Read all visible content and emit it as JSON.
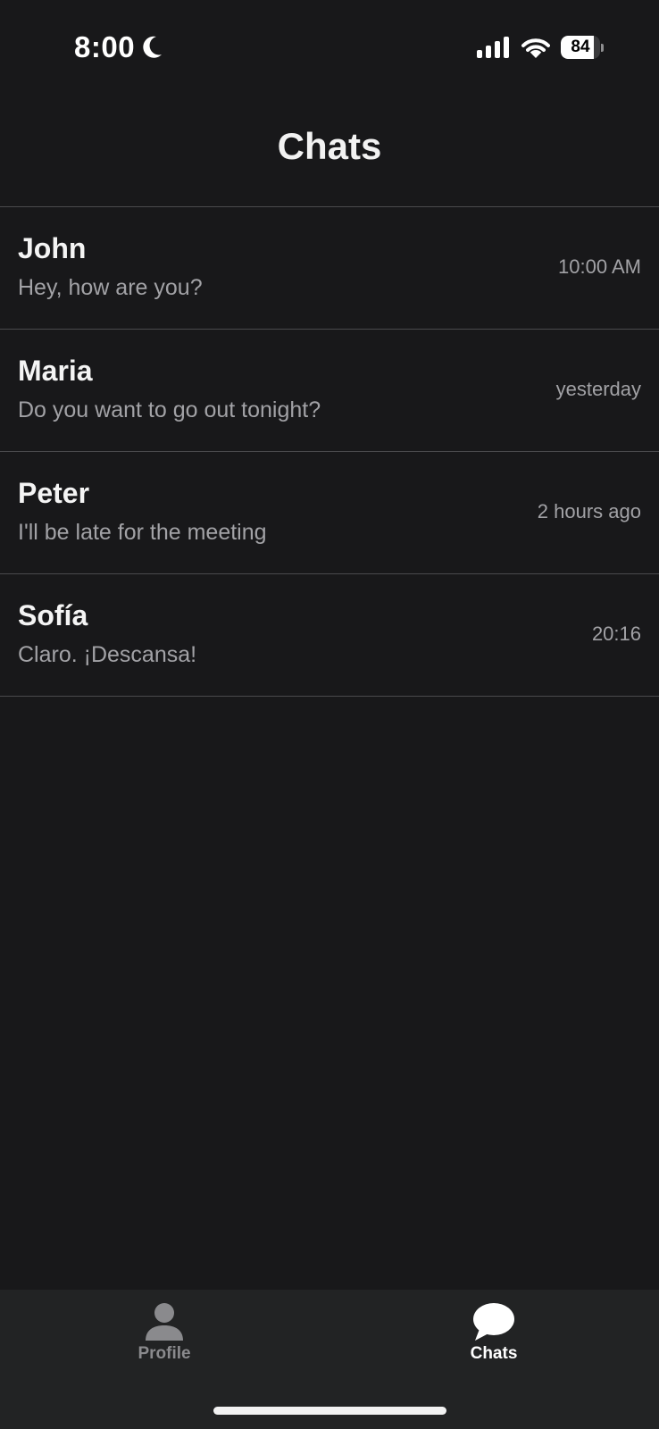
{
  "status_bar": {
    "time": "8:00",
    "battery_level": "84"
  },
  "header": {
    "title": "Chats"
  },
  "chats": [
    {
      "name": "John",
      "preview": "Hey, how are you?",
      "time": "10:00 AM"
    },
    {
      "name": "Maria",
      "preview": "Do you want to go out tonight?",
      "time": "yesterday"
    },
    {
      "name": "Peter",
      "preview": "I'll be late for the meeting",
      "time": "2 hours ago"
    },
    {
      "name": "Sofía",
      "preview": "Claro. ¡Descansa!",
      "time": "20:16"
    }
  ],
  "tab_bar": {
    "tabs": [
      {
        "label": "Profile",
        "icon": "person-icon",
        "active": false
      },
      {
        "label": "Chats",
        "icon": "chat-bubble-icon",
        "active": true
      }
    ]
  },
  "colors": {
    "background": "#18181a",
    "tab_bar_background": "#222324",
    "active_tab": "#ffffff",
    "inactive_tab": "#8a8a8d",
    "secondary_text": "#a2a2a6",
    "divider": "#4a4a4d"
  }
}
